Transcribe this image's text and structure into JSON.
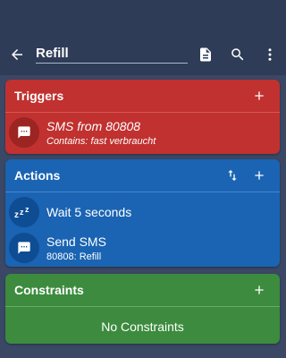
{
  "app_bar": {
    "title": "Refill",
    "icons": [
      "back-arrow-icon",
      "document-icon",
      "search-icon",
      "more-vert-icon"
    ]
  },
  "triggers": {
    "title": "Triggers",
    "color": "#c0312f",
    "items": [
      {
        "main": "SMS from 80808",
        "sub": "Contains: fast verbraucht",
        "icon": "sms-icon"
      }
    ]
  },
  "actions": {
    "title": "Actions",
    "color": "#1a64b3",
    "items": [
      {
        "main": "Wait 5 seconds",
        "icon": "sleep-zzz-icon"
      },
      {
        "main": "Send SMS",
        "sub": "80808: Refill",
        "icon": "sms-icon"
      }
    ]
  },
  "constraints": {
    "title": "Constraints",
    "color": "#3c8b3e",
    "empty_text": "No Constraints"
  }
}
